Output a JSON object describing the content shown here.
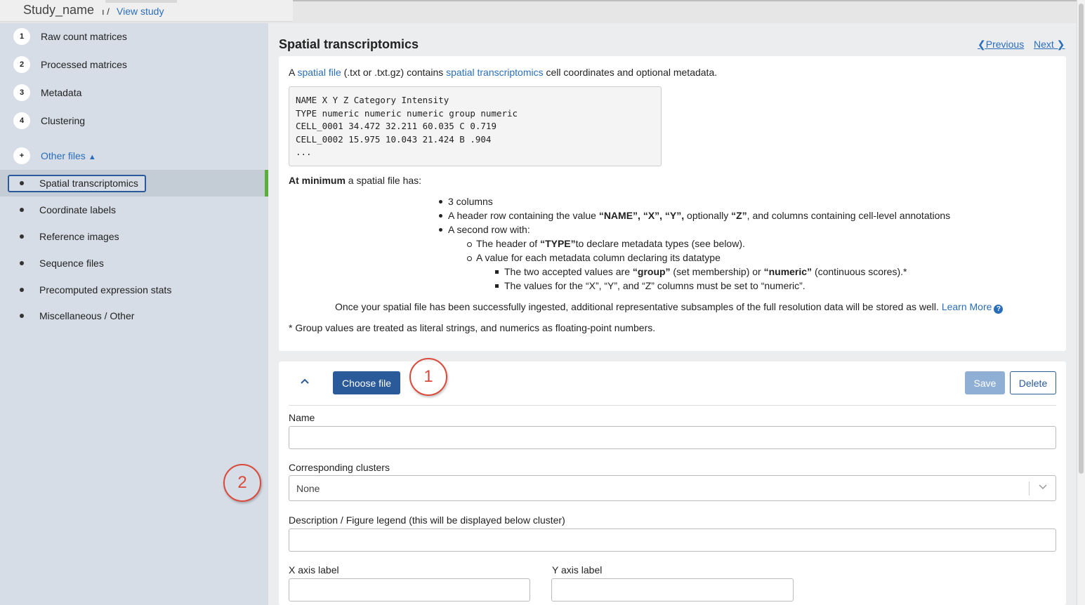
{
  "header": {
    "study_name": "Study_name",
    "separator": "ı /",
    "view_study": "View study"
  },
  "sidebar": {
    "steps": [
      {
        "num": "1",
        "label": "Raw count matrices"
      },
      {
        "num": "2",
        "label": "Processed matrices"
      },
      {
        "num": "3",
        "label": "Metadata"
      },
      {
        "num": "4",
        "label": "Clustering"
      }
    ],
    "other": {
      "num": "+",
      "label": "Other files"
    },
    "sub_items": [
      {
        "label": "Spatial transcriptomics",
        "active": true
      },
      {
        "label": "Coordinate labels"
      },
      {
        "label": "Reference images"
      },
      {
        "label": "Sequence files"
      },
      {
        "label": "Precomputed expression stats"
      },
      {
        "label": "Miscellaneous / Other"
      }
    ]
  },
  "main": {
    "title": "Spatial transcriptomics",
    "prev_label": "Previous",
    "next_label": "Next",
    "intro": {
      "a": "A ",
      "spatial_file": "spatial file",
      "mid": " (.txt or .txt.gz) contains ",
      "spatial_tx": "spatial transcriptomics",
      "end": " cell coordinates and optional metadata."
    },
    "code": "NAME X Y Z Category Intensity\nTYPE numeric numeric numeric group numeric\nCELL_0001 34.472 32.211 60.035 C 0.719\nCELL_0002 15.975 10.043 21.424 B .904\n...",
    "minimum_bold": "At minimum",
    "minimum_rest": " a spatial file has:",
    "bullets": {
      "b1": "3 columns",
      "b2_a": "A header row containing the value ",
      "b2_b": "“NAME”, “X”, “Y”,",
      "b2_c": " optionally ",
      "b2_d": "“Z”",
      "b2_e": ", and columns containing cell-level annotations",
      "b3": "A second row with:",
      "c1_a": "The header of ",
      "c1_b": "“TYPE”",
      "c1_c": "to declare metadata types (see below).",
      "c2": "A value for each metadata column declaring its datatype",
      "s1_a": "The two accepted values are ",
      "s1_b": "“group”",
      "s1_c": " (set membership) or ",
      "s1_d": "“numeric”",
      "s1_e": " (continuous scores).*",
      "s2": "The values for the “X”, “Y”, and “Z” columns must be set to “numeric”."
    },
    "ingest_text": "Once your spatial file has been successfully ingested, additional representative subsamples of the full resolution data will be stored as well.",
    "learn_more": "Learn More",
    "footnote": "* Group values are treated as literal strings, and numerics as floating-point numbers."
  },
  "form": {
    "choose_file": "Choose file",
    "save": "Save",
    "delete": "Delete",
    "name_label": "Name",
    "name_value": "",
    "clusters_label": "Corresponding clusters",
    "clusters_value": "None",
    "description_label": "Description / Figure legend (this will be displayed below cluster)",
    "description_value": "",
    "x_label": "X axis label",
    "y_label": "Y axis label"
  },
  "annotations": {
    "a1": "1",
    "a2": "2"
  },
  "colors": {
    "accent": "#2a6ebb",
    "primary_button": "#2a5a9a",
    "active_bar": "#5aae3a",
    "annotation": "#d94a3b"
  }
}
